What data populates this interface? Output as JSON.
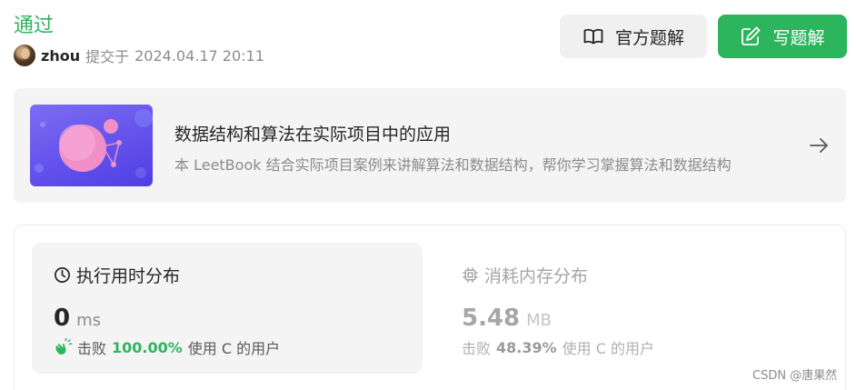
{
  "submission": {
    "status": "通过",
    "username": "zhou",
    "submitted_label": "提交于",
    "submitted_time": "2024.04.17 20:11"
  },
  "actions": {
    "official_solution": "官方题解",
    "write_solution": "写题解"
  },
  "book": {
    "title": "数据结构和算法在实际项目中的应用",
    "description": "本 LeetBook 结合实际项目案例来讲解算法和数据结构，帮你学习掌握算法和数据结构"
  },
  "runtime": {
    "heading": "执行用时分布",
    "value": "0",
    "unit": "ms",
    "beats_label": "击败",
    "beats_pct": "100.00%",
    "beats_suffix": "使用 C 的用户"
  },
  "memory": {
    "heading": "消耗内存分布",
    "value": "5.48",
    "unit": "MB",
    "beats_label": "击败",
    "beats_pct": "48.39%",
    "beats_suffix": "使用 C 的用户"
  },
  "watermark": "CSDN @唐果然",
  "colors": {
    "accent_green": "#2db55d",
    "muted_text": "#8c8c8c",
    "card_bg": "#f4f4f5"
  },
  "icons": {
    "official_solution": "book-open-icon",
    "write_solution": "edit-icon",
    "book_arrow": "arrow-right-icon",
    "runtime": "clock-icon",
    "memory": "chip-icon",
    "beats": "clapping-hands-icon"
  }
}
